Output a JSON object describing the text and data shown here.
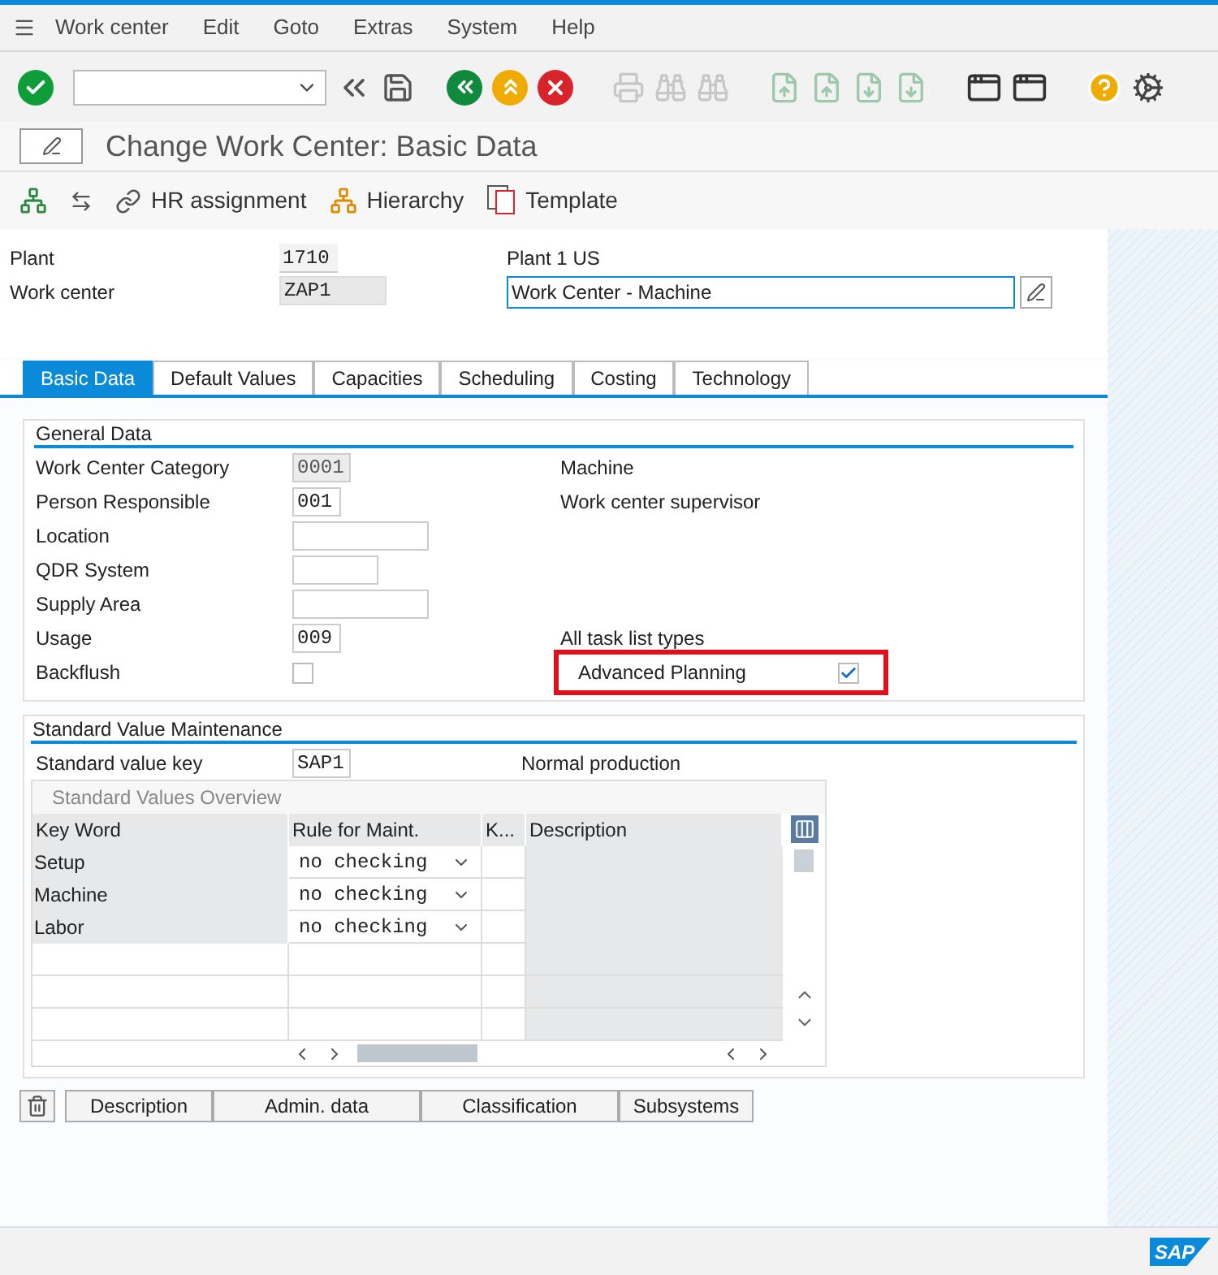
{
  "menu": [
    "Work center",
    "Edit",
    "Goto",
    "Extras",
    "System",
    "Help"
  ],
  "title": "Change Work Center: Basic Data",
  "app_toolbar": [
    {
      "kind": "icon"
    },
    {
      "kind": "icon"
    },
    {
      "kind": "link",
      "label": "HR assignment"
    },
    {
      "kind": "hierarchy",
      "label": "Hierarchy"
    },
    {
      "kind": "template",
      "label": "Template"
    }
  ],
  "header": {
    "plant_label": "Plant",
    "plant": "1710",
    "plant_desc": "Plant 1 US",
    "wc_label": "Work center",
    "wc": "ZAP1",
    "wc_desc": "Work Center - Machine"
  },
  "tabs": [
    {
      "label": "Basic Data",
      "selected": true
    },
    {
      "label": "Default Values",
      "selected": false
    },
    {
      "label": "Capacities",
      "selected": false
    },
    {
      "label": "Scheduling",
      "selected": false
    },
    {
      "label": "Costing",
      "selected": false
    },
    {
      "label": "Technology",
      "selected": false
    }
  ],
  "general_data": {
    "title": "General Data",
    "fields": [
      {
        "kind": "input",
        "label": "Work Center Category",
        "value": "0001",
        "readonly": true,
        "desc": "Machine"
      },
      {
        "kind": "input",
        "label": "Person Responsible",
        "value": "001",
        "readonly": false,
        "desc": "Work center supervisor"
      },
      {
        "kind": "input",
        "label": "Location",
        "readonly": false
      },
      {
        "kind": "input",
        "label": "QDR System",
        "readonly": false
      },
      {
        "kind": "input",
        "label": "Supply Area",
        "readonly": false
      },
      {
        "kind": "input",
        "label": "Usage",
        "value": "009",
        "readonly": false,
        "desc": "All task list types"
      },
      {
        "kind": "checkbox",
        "label": "Backflush",
        "checked": false,
        "side": {
          "label": "Advanced Planning",
          "checked": true,
          "highlighted": true
        }
      }
    ]
  },
  "standard_values": {
    "title": "Standard Value Maintenance",
    "key_label": "Standard value key",
    "key": "SAP1",
    "key_desc": "Normal production",
    "table": {
      "title": "Standard Values Overview",
      "columns": [
        "Key Word",
        "Rule for Maint.",
        "K...",
        "Description"
      ],
      "rows": [
        {
          "key_word": "Setup",
          "rule": "no checking"
        },
        {
          "key_word": "Machine",
          "rule": "no checking"
        },
        {
          "key_word": "Labor",
          "rule": "no checking"
        }
      ]
    }
  },
  "bottom_buttons": [
    "Description",
    "Admin. data",
    "Classification",
    "Subsystems"
  ],
  "logo": "SAP"
}
